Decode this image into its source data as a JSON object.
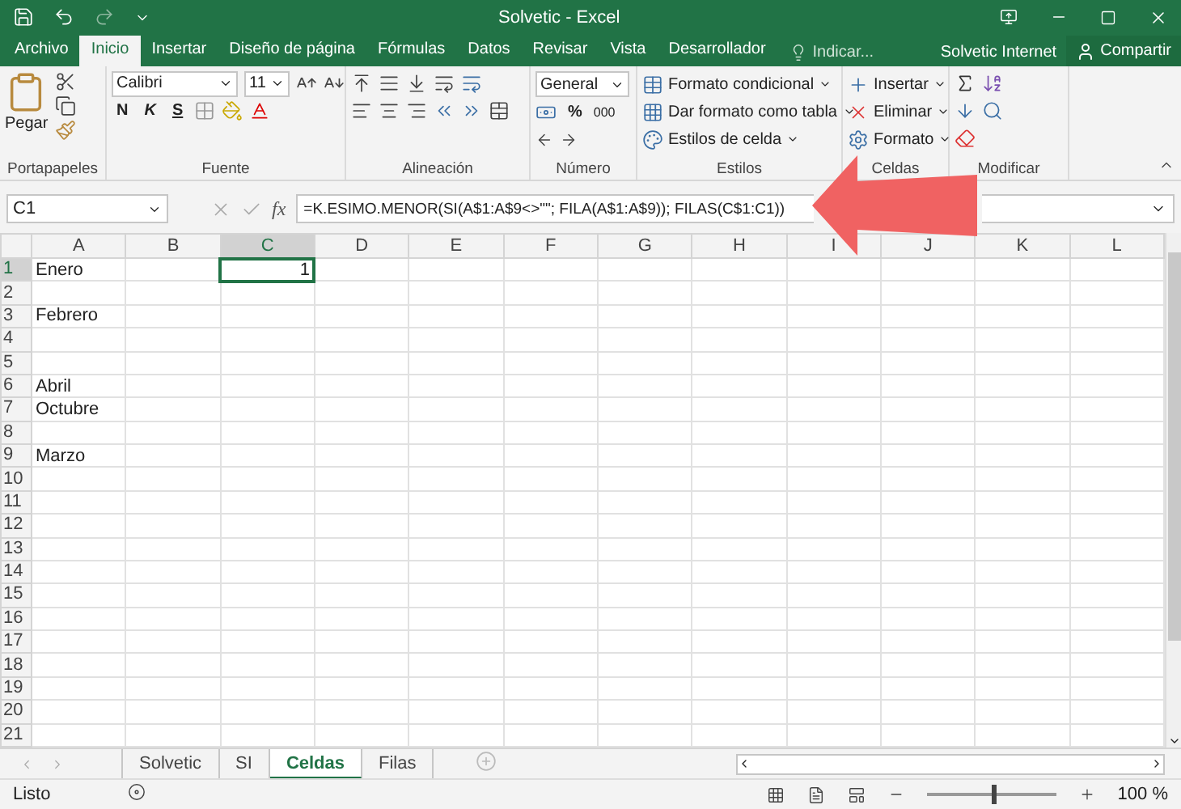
{
  "window": {
    "title": "Solvetic - Excel"
  },
  "ribbon_tabs": [
    {
      "label": "Archivo",
      "selected": false
    },
    {
      "label": "Inicio",
      "selected": true
    },
    {
      "label": "Insertar",
      "selected": false
    },
    {
      "label": "Diseño de página",
      "selected": false
    },
    {
      "label": "Fórmulas",
      "selected": false
    },
    {
      "label": "Datos",
      "selected": false
    },
    {
      "label": "Revisar",
      "selected": false
    },
    {
      "label": "Vista",
      "selected": false
    },
    {
      "label": "Desarrollador",
      "selected": false
    }
  ],
  "tell_me": {
    "placeholder": "Indicar..."
  },
  "account": "Solvetic Internet",
  "share": "Compartir",
  "ribbon": {
    "clipboard": {
      "paste": "Pegar",
      "label": "Portapapeles"
    },
    "font": {
      "name": "Calibri",
      "size": "11",
      "bold": "N",
      "italic": "K",
      "underline": "S",
      "label": "Fuente"
    },
    "alignment": {
      "label": "Alineación"
    },
    "number": {
      "format": "General",
      "percent": "%",
      "thousands": "000",
      "label": "Número"
    },
    "styles": {
      "items": [
        "Formato condicional",
        "Dar formato como tabla",
        "Estilos de celda"
      ],
      "label": "Estilos"
    },
    "cells": {
      "items": [
        "Insertar",
        "Eliminar",
        "Formato"
      ],
      "label": "Celdas"
    },
    "editing": {
      "label": "Modificar"
    }
  },
  "formula_bar": {
    "name_box": "C1",
    "function_label": "fx",
    "formula": "=K.ESIMO.MENOR(SI(A$1:A$9<>\"\"; FILA(A$1:A$9)); FILAS(C$1:C1))"
  },
  "grid": {
    "columns": [
      {
        "label": "A",
        "selected": false
      },
      {
        "label": "B",
        "selected": false
      },
      {
        "label": "C",
        "selected": true
      },
      {
        "label": "D",
        "selected": false
      },
      {
        "label": "E",
        "selected": false
      },
      {
        "label": "F",
        "selected": false
      },
      {
        "label": "G",
        "selected": false
      },
      {
        "label": "H",
        "selected": false
      },
      {
        "label": "I",
        "selected": false
      },
      {
        "label": "J",
        "selected": false
      },
      {
        "label": "K",
        "selected": false
      },
      {
        "label": "L",
        "selected": false
      }
    ],
    "rows": [
      {
        "label": "1",
        "selected": true,
        "a": "Enero",
        "c": {
          "text": "1",
          "selected": true
        }
      },
      {
        "label": "2",
        "selected": false
      },
      {
        "label": "3",
        "selected": false,
        "a": "Febrero"
      },
      {
        "label": "4",
        "selected": false
      },
      {
        "label": "5",
        "selected": false
      },
      {
        "label": "6",
        "selected": false,
        "a": "Abril"
      },
      {
        "label": "7",
        "selected": false,
        "a": "Octubre"
      },
      {
        "label": "8",
        "selected": false
      },
      {
        "label": "9",
        "selected": false,
        "a": "Marzo"
      },
      {
        "label": "10",
        "selected": false
      },
      {
        "label": "11",
        "selected": false
      },
      {
        "label": "12",
        "selected": false
      },
      {
        "label": "13",
        "selected": false
      },
      {
        "label": "14",
        "selected": false
      },
      {
        "label": "15",
        "selected": false
      },
      {
        "label": "16",
        "selected": false
      },
      {
        "label": "17",
        "selected": false
      },
      {
        "label": "18",
        "selected": false
      },
      {
        "label": "19",
        "selected": false
      },
      {
        "label": "20",
        "selected": false
      },
      {
        "label": "21",
        "selected": false
      }
    ]
  },
  "sheet_tabs": [
    {
      "label": "Solvetic",
      "selected": false
    },
    {
      "label": "SI",
      "selected": false
    },
    {
      "label": "Celdas",
      "selected": true
    },
    {
      "label": "Filas",
      "selected": false
    }
  ],
  "status_bar": {
    "status": "Listo",
    "zoom": {
      "label": "100 %",
      "level": 0.5
    }
  }
}
